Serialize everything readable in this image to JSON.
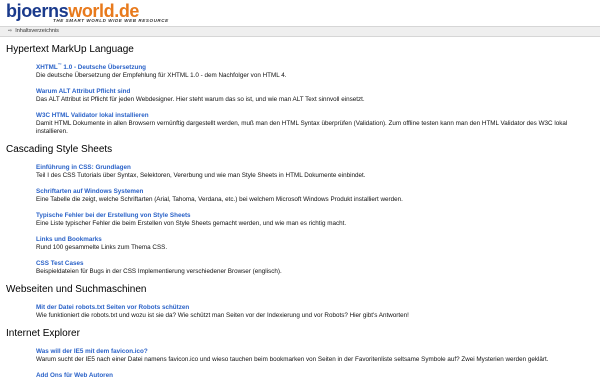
{
  "site": {
    "logo_part1": "bjoerns",
    "logo_part2": "world.de",
    "tagline": "THE SMART WORLD WIDE WEB RESOURCE",
    "breadcrumb": "Inhaltsverzeichnis"
  },
  "sections": [
    {
      "title": "Hypertext MarkUp Language",
      "items": [
        {
          "title": "XHTML",
          "title_sup": "™",
          "title_rest": " 1.0 - Deutsche Übersetzung",
          "desc": "Die deutsche Übersetzung der Empfehlung für XHTML 1.0 - dem Nachfolger von HTML 4."
        },
        {
          "title": "Warum ALT Attribut Pflicht sind",
          "desc": "Das ALT Attribut ist Pflicht für jeden Webdesigner. Hier steht warum das so ist, und wie man ALT Text sinnvoll einsetzt."
        },
        {
          "title": "W3C HTML Validator lokal installieren",
          "desc": "Damit HTML Dokumente in allen Browsern vernünftig dargestellt werden, muß man den HTML Syntax überprüfen (Validation). Zum offline testen kann man den HTML Validator des W3C lokal installieren."
        }
      ]
    },
    {
      "title": "Cascading Style Sheets",
      "items": [
        {
          "title": "Einführung in CSS: Grundlagen",
          "desc": "Teil I des CSS Tutorials über Syntax, Selektoren, Vererbung und wie man Style Sheets in HTML Dokumente einbindet."
        },
        {
          "title": "Schriftarten auf Windows Systemen",
          "desc": "Eine Tabelle die zeigt, welche Schriftarten (Arial, Tahoma, Verdana, etc.) bei welchem Microsoft Windows Produkt installiert werden."
        },
        {
          "title": "Typische Fehler bei der Erstellung von Style Sheets",
          "desc": "Eine Liste typischer Fehler die beim Erstellen von Style Sheets gemacht werden, und wie man es richtig macht."
        },
        {
          "title": "Links und Bookmarks",
          "desc": "Rund 100 gesammelte Links zum Thema CSS."
        },
        {
          "title": "CSS Test Cases",
          "desc": "Beispieldateien für Bugs in der CSS Implementierung verschiedener Browser (englisch)."
        }
      ]
    },
    {
      "title": "Webseiten und Suchmaschinen",
      "items": [
        {
          "title": "Mit der Datei robots.txt Seiten vor Robots schützen",
          "desc": "Wie funktioniert die robots.txt und wozu ist sie da? Wie schützt man Seiten vor der Indexierung und vor Robots? Hier gibt's Antworten!"
        }
      ]
    },
    {
      "title": "Internet Explorer",
      "items": [
        {
          "title": "Was will der IE5 mit dem favicon.ico?",
          "desc": "Warum sucht der IE5 nach einer Datei namens favicon.ico und wieso tauchen beim bookmarken von Seiten in der Favoritenliste seltsame Symbole auf? Zwei Mysterien werden geklärt."
        },
        {
          "title": "Add Ons für Web Autoren",
          "desc": ""
        }
      ]
    }
  ]
}
